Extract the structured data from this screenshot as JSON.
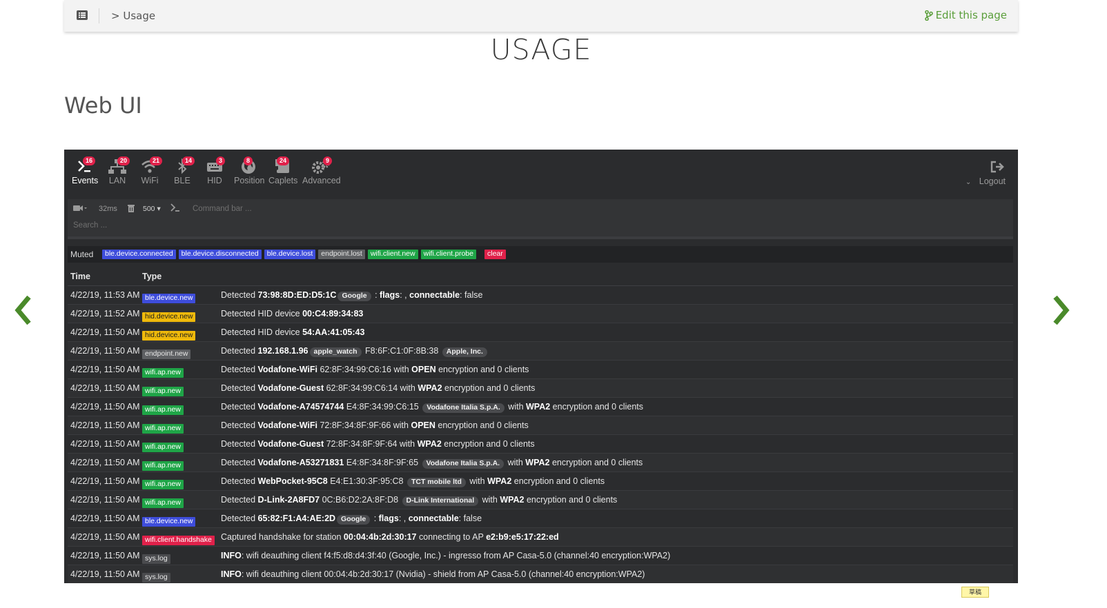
{
  "header": {
    "breadcrumb": "> Usage",
    "edit_link": "Edit this page"
  },
  "page_title": "USAGE",
  "section_title": "Web UI",
  "ui": {
    "tabs": [
      {
        "label": "Events",
        "badge": "16"
      },
      {
        "label": "LAN",
        "badge": "20"
      },
      {
        "label": "WiFi",
        "badge": "21"
      },
      {
        "label": "BLE",
        "badge": "14"
      },
      {
        "label": "HID",
        "badge": "3"
      },
      {
        "label": "Position",
        "badge": "8"
      },
      {
        "label": "Caplets",
        "badge": "24"
      },
      {
        "label": "Advanced",
        "badge": "9"
      }
    ],
    "logout_label": "Logout",
    "cmd": {
      "interval": "32ms",
      "limit": "500",
      "command_placeholder": "Command bar ...",
      "search_placeholder": "Search ..."
    },
    "muted": {
      "label": "Muted",
      "tags": [
        "ble.device.connected",
        "ble.device.disconnected",
        "ble.device.lost",
        "endpoint.lost",
        "wifi.client.new",
        "wifi.client.probe"
      ],
      "clear_label": "clear"
    },
    "table": {
      "col_time": "Time",
      "col_type": "Type",
      "rows": [
        {
          "time": "4/22/19, 11:53 AM",
          "type": "ble.device.new",
          "msg": [
            {
              "t": "Detected "
            },
            {
              "b": "73:98:8D:ED:D5:1C"
            },
            {
              "p": "Google"
            },
            {
              "t": " : "
            },
            {
              "b": "flags"
            },
            {
              "t": ": , "
            },
            {
              "b": "connectable"
            },
            {
              "t": ": false"
            }
          ]
        },
        {
          "time": "4/22/19, 11:52 AM",
          "type": "hid.device.new",
          "msg": [
            {
              "t": "Detected HID device "
            },
            {
              "b": "00:C4:89:34:83"
            }
          ]
        },
        {
          "time": "4/22/19, 11:50 AM",
          "type": "hid.device.new",
          "msg": [
            {
              "t": "Detected HID device "
            },
            {
              "b": "54:AA:41:05:43"
            }
          ]
        },
        {
          "time": "4/22/19, 11:50 AM",
          "type": "endpoint.new",
          "msg": [
            {
              "t": "Detected "
            },
            {
              "b": "192.168.1.96"
            },
            {
              "p": "apple_watch"
            },
            {
              "t": " F8:6F:C1:0F:8B:38 "
            },
            {
              "p": "Apple, Inc."
            }
          ]
        },
        {
          "time": "4/22/19, 11:50 AM",
          "type": "wifi.ap.new",
          "msg": [
            {
              "t": "Detected "
            },
            {
              "b": "Vodafone-WiFi"
            },
            {
              "t": " 62:8F:34:99:C6:16 with "
            },
            {
              "b": "OPEN"
            },
            {
              "t": " encryption and 0 clients"
            }
          ]
        },
        {
          "time": "4/22/19, 11:50 AM",
          "type": "wifi.ap.new",
          "msg": [
            {
              "t": "Detected "
            },
            {
              "b": "Vodafone-Guest"
            },
            {
              "t": " 62:8F:34:99:C6:14 with "
            },
            {
              "b": "WPA2"
            },
            {
              "t": " encryption and 0 clients"
            }
          ]
        },
        {
          "time": "4/22/19, 11:50 AM",
          "type": "wifi.ap.new",
          "msg": [
            {
              "t": "Detected "
            },
            {
              "b": "Vodafone-A74574744"
            },
            {
              "t": " E4:8F:34:99:C6:15 "
            },
            {
              "p": "Vodafone Italia S.p.A."
            },
            {
              "t": " with "
            },
            {
              "b": "WPA2"
            },
            {
              "t": " encryption and 0 clients"
            }
          ]
        },
        {
          "time": "4/22/19, 11:50 AM",
          "type": "wifi.ap.new",
          "msg": [
            {
              "t": "Detected "
            },
            {
              "b": "Vodafone-WiFi"
            },
            {
              "t": " 72:8F:34:8F:9F:66 with "
            },
            {
              "b": "OPEN"
            },
            {
              "t": " encryption and 0 clients"
            }
          ]
        },
        {
          "time": "4/22/19, 11:50 AM",
          "type": "wifi.ap.new",
          "msg": [
            {
              "t": "Detected "
            },
            {
              "b": "Vodafone-Guest"
            },
            {
              "t": " 72:8F:34:8F:9F:64 with "
            },
            {
              "b": "WPA2"
            },
            {
              "t": " encryption and 0 clients"
            }
          ]
        },
        {
          "time": "4/22/19, 11:50 AM",
          "type": "wifi.ap.new",
          "msg": [
            {
              "t": "Detected "
            },
            {
              "b": "Vodafone-A53271831"
            },
            {
              "t": " E4:8F:34:8F:9F:65 "
            },
            {
              "p": "Vodafone Italia S.p.A."
            },
            {
              "t": " with "
            },
            {
              "b": "WPA2"
            },
            {
              "t": " encryption and 0 clients"
            }
          ]
        },
        {
          "time": "4/22/19, 11:50 AM",
          "type": "wifi.ap.new",
          "msg": [
            {
              "t": "Detected "
            },
            {
              "b": "WebPocket-95C8"
            },
            {
              "t": " E4:E1:30:3F:95:C8 "
            },
            {
              "p": "TCT mobile ltd"
            },
            {
              "t": " with "
            },
            {
              "b": "WPA2"
            },
            {
              "t": " encryption and 0 clients"
            }
          ]
        },
        {
          "time": "4/22/19, 11:50 AM",
          "type": "wifi.ap.new",
          "msg": [
            {
              "t": "Detected "
            },
            {
              "b": "D-Link-2A8FD7"
            },
            {
              "t": " 0C:B6:D2:2A:8F:D8 "
            },
            {
              "p": "D-Link International"
            },
            {
              "t": " with "
            },
            {
              "b": "WPA2"
            },
            {
              "t": " encryption and 0 clients"
            }
          ]
        },
        {
          "time": "4/22/19, 11:50 AM",
          "type": "ble.device.new",
          "msg": [
            {
              "t": "Detected "
            },
            {
              "b": "65:82:F1:A4:AE:2D"
            },
            {
              "p": "Google"
            },
            {
              "t": " : "
            },
            {
              "b": "flags"
            },
            {
              "t": ": , "
            },
            {
              "b": "connectable"
            },
            {
              "t": ": false"
            }
          ]
        },
        {
          "time": "4/22/19, 11:50 AM",
          "type": "wifi.client.handshake",
          "msg": [
            {
              "t": "Captured handshake for station "
            },
            {
              "b": "00:04:4b:2d:30:17"
            },
            {
              "t": " connecting to AP "
            },
            {
              "b": "e2:b9:e5:17:22:ed"
            }
          ]
        },
        {
          "time": "4/22/19, 11:50 AM",
          "type": "sys.log",
          "msg": [
            {
              "b": "INFO"
            },
            {
              "t": ": wifi deauthing client f4:f5:d8:d4:3f:40 (Google, Inc.) - ingresso from AP Casa-5.0 (channel:40 encryption:WPA2)"
            }
          ]
        },
        {
          "time": "4/22/19, 11:50 AM",
          "type": "sys.log",
          "msg": [
            {
              "b": "INFO"
            },
            {
              "t": ": wifi deauthing client 00:04:4b:2d:30:17 (Nvidia) - shield from AP Casa-5.0 (channel:40 encryption:WPA2)"
            }
          ]
        }
      ]
    }
  },
  "corner_note": "草稿",
  "colors": {
    "brand_green": "#5a9e3a",
    "badge_red": "#e0214a",
    "tag_blue": "#3e4ddb",
    "tag_green": "#1fa547",
    "tag_yellow": "#efb90b",
    "panel_bg": "#2b2c2e"
  }
}
